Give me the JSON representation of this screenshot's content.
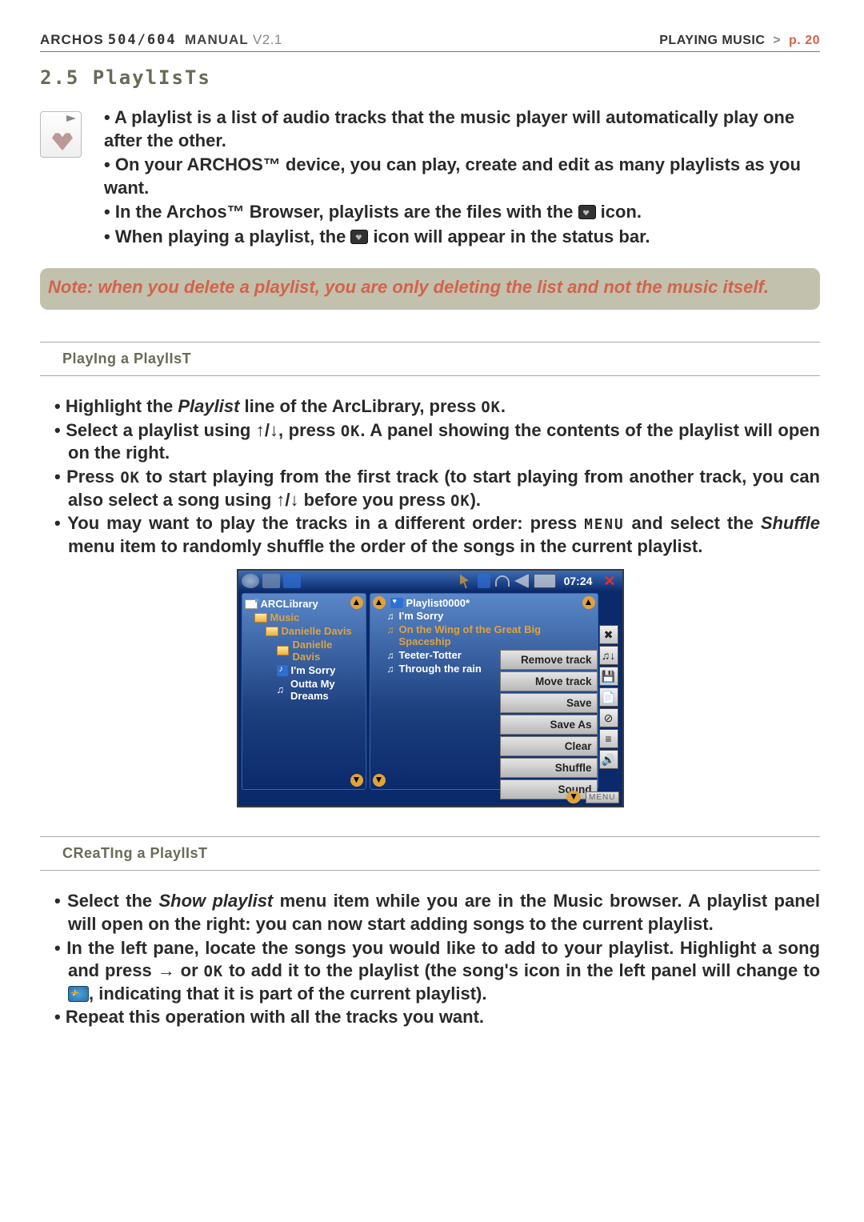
{
  "header": {
    "brand": "ARCHOS",
    "model": "504/604",
    "manual": "MANUAL",
    "version": "V2.1",
    "breadcrumb_section": "PLAYING MUSIC",
    "breadcrumb_arrow": ">",
    "page_label": "p. 20"
  },
  "section": {
    "number_title": "2.5  PlaylIsTs"
  },
  "intro_bullets": [
    "A playlist is a list of audio tracks that the music player will automatically play one after the other.",
    "On your ARCHOS™ device, you can play, create and edit as many playlists as you want.",
    "In the Archos™ Browser, playlists are the files with the  icon.",
    "When playing a playlist, the  icon will appear in the status bar."
  ],
  "note_text": "Note: when you delete a playlist, you are only deleting the list and not the music itself.",
  "sub1_title": "PlayIng a PlaylIsT",
  "play_steps": {
    "s1_a": "Highlight the ",
    "s1_i": "Playlist",
    "s1_b": " line of the ArcLibrary, press ",
    "ok": "OK",
    "s1_c": ".",
    "s2_a": "Select a playlist using ",
    "updn": "↑/↓",
    "s2_b": ", press ",
    "s2_c": ". A panel showing the contents of the playlist will open on the right.",
    "s3_a": "Press ",
    "s3_b": " to start playing from the first track (to start playing from another track, you can also select a song using ",
    "s3_c": " before you press ",
    "s3_d": ").",
    "s4_a": "You may want to play the tracks in a different order: press ",
    "menu": "MENU",
    "s4_b": " and select the ",
    "s4_i": "Shuffle",
    "s4_c": " menu item to randomly shuffle the order of the songs in the current playlist."
  },
  "screenshot": {
    "time": "07:24",
    "left_tree": {
      "root": "ARCLibrary",
      "lvl1": "Music",
      "lvl2a": "Danielle Davis",
      "lvl2b": "Danielle Davis",
      "song1": "I'm Sorry",
      "song2": "Outta My Dreams"
    },
    "right_pane": {
      "title": "Playlist0000*",
      "tracks": [
        "I'm Sorry",
        "On the Wing of the Great Big Spaceship",
        "Teeter-Totter",
        "Through the rain"
      ]
    },
    "menu_items": [
      "Remove track",
      "Move track",
      "Save",
      "Save As",
      "Clear",
      "Shuffle",
      "Sound"
    ],
    "menu_label": "MENU"
  },
  "sub2_title": "CReaTIng a PlaylIsT",
  "create_steps": {
    "c1_a": "Select the ",
    "c1_i": "Show playlist",
    "c1_b": " menu item while you are in the Music browser. A playlist panel will open on the right: you can now start adding songs to the current playlist.",
    "c2_a": "In the left pane, locate the songs you would like to add to your playlist. Highlight a song and press ",
    "right_arrow": "→",
    "c2_b": " or ",
    "c2_c": " to add it to the playlist (the song's icon in the left panel will change to ",
    "c2_d": ", indicating that it is part of the current playlist).",
    "c3": "Repeat this operation with all the tracks you want."
  }
}
